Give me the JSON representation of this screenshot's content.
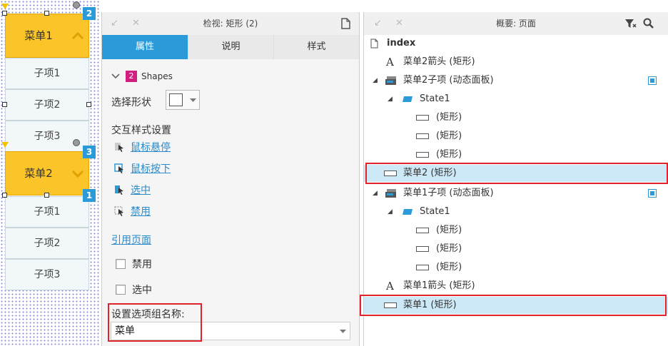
{
  "canvas": {
    "menu1": {
      "label": "菜单1",
      "badge": "2",
      "sub_items": [
        "子项1",
        "子项2",
        "子项3"
      ]
    },
    "menu2": {
      "label": "菜单2",
      "badge": "3",
      "badge_below": "1",
      "sub_items": [
        "子项1",
        "子项2",
        "子项3"
      ]
    }
  },
  "inspector": {
    "title": "检视: 矩形 (2)",
    "tabs": [
      "属性",
      "说明",
      "样式"
    ],
    "active_tab": "属性",
    "shapes_count": "2",
    "shapes_label": "Shapes",
    "select_shape_label": "选择形状",
    "interaction_style_title": "交互样式设置",
    "interaction_links": [
      "鼠标悬停",
      "鼠标按下",
      "选中",
      "禁用"
    ],
    "reference_page_link": "引用页面",
    "checkbox_disabled": "禁用",
    "checkbox_selected": "选中",
    "option_group_label": "设置选项组名称:",
    "option_group_value": "菜单"
  },
  "outline": {
    "title": "概要: 页面",
    "items": [
      {
        "text": "index",
        "icon": "page-icon"
      },
      {
        "text": "菜单2箭头 (矩形)",
        "icon": "text-icon"
      },
      {
        "text": "菜单2子项 (动态面板)",
        "icon": "dynamic-panel-icon"
      },
      {
        "text": "State1",
        "icon": "state-icon"
      },
      {
        "text": "(矩形)",
        "icon": "rect-icon"
      },
      {
        "text": "(矩形)",
        "icon": "rect-icon"
      },
      {
        "text": "(矩形)",
        "icon": "rect-icon"
      },
      {
        "text": "菜单2 (矩形)",
        "icon": "rect-icon"
      },
      {
        "text": "菜单1子项 (动态面板)",
        "icon": "dynamic-panel-icon"
      },
      {
        "text": "State1",
        "icon": "state-icon"
      },
      {
        "text": "(矩形)",
        "icon": "rect-icon"
      },
      {
        "text": "(矩形)",
        "icon": "rect-icon"
      },
      {
        "text": "(矩形)",
        "icon": "rect-icon"
      },
      {
        "text": "菜单1箭头 (矩形)",
        "icon": "text-icon"
      },
      {
        "text": "菜单1 (矩形)",
        "icon": "rect-icon"
      }
    ]
  },
  "colors": {
    "accent_blue": "#2a9bd8",
    "menu_yellow": "#fbc52a",
    "selection_blue": "#cde8f6",
    "highlight_red": "#e0222a"
  }
}
